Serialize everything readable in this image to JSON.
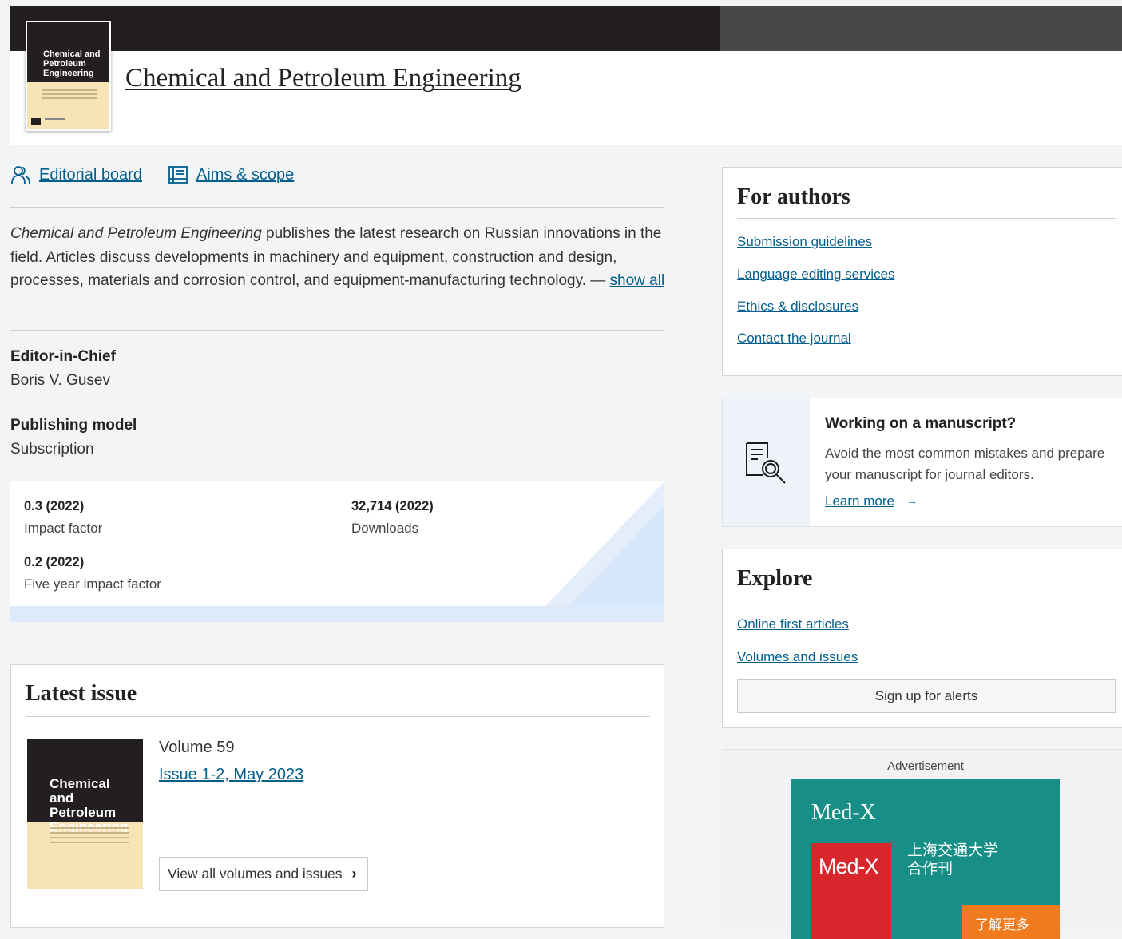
{
  "header": {
    "journal_title": "Chemical and Petroleum Engineering",
    "cover_text": "Chemical and Petroleum Engineering"
  },
  "quicklinks": {
    "editorial_board": "Editorial board",
    "aims_scope": "Aims & scope"
  },
  "description": {
    "journal_name_italic": "Chemical and Petroleum Engineering",
    "text": " publishes the latest research on Russian innovations in the field. Articles discuss developments in machinery and equipment, construction and design, processes, materials and corrosion control, and equipment-manufacturing technology. — ",
    "show_all": "show all"
  },
  "editor": {
    "label": "Editor-in-Chief",
    "name": "Boris V. Gusev"
  },
  "publishing": {
    "label": "Publishing model",
    "value": "Subscription"
  },
  "metrics": {
    "impact_factor_value": "0.3 (2022)",
    "impact_factor_label": "Impact factor",
    "downloads_value": "32,714 (2022)",
    "downloads_label": "Downloads",
    "five_year_value": "0.2 (2022)",
    "five_year_label": "Five year impact factor"
  },
  "latest_issue": {
    "title": "Latest issue",
    "cover_text": "Chemical and Petroleum Engineering",
    "volume": "Volume 59",
    "issue": "Issue 1-2, May 2023",
    "view_all": "View all volumes and issues"
  },
  "for_authors": {
    "title": "For authors",
    "links": [
      "Submission guidelines",
      "Language editing services",
      "Ethics & disclosures",
      "Contact the journal"
    ]
  },
  "manuscript": {
    "title": "Working on a manuscript?",
    "text": "Avoid the most common mistakes and prepare your manuscript for journal editors.",
    "link": "Learn more",
    "arrow": "→"
  },
  "explore": {
    "title": "Explore",
    "links": [
      "Online first articles",
      "Volumes and issues"
    ],
    "signup": "Sign up for alerts"
  },
  "advertisement": {
    "label": "Advertisement",
    "logo": "Med-X",
    "book_title": "Med-X",
    "cn_line1": "上海交通大学",
    "cn_line2": "合作刊",
    "button": "了解更多"
  },
  "colors": {
    "link": "#025e8d",
    "topbar": "#231f20",
    "ad_teal": "#178f86",
    "ad_orange": "#f07b1f"
  }
}
